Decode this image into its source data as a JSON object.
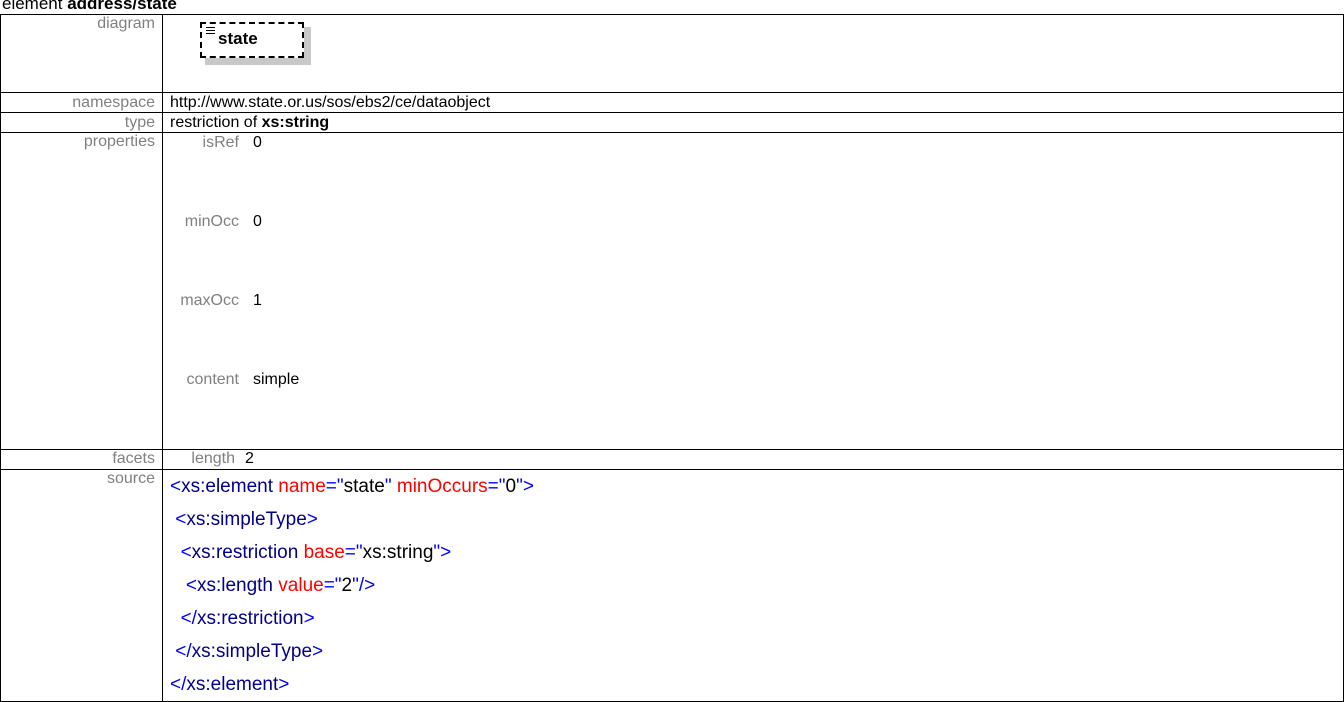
{
  "title": {
    "prefix": "element ",
    "name": "address/state"
  },
  "rows": {
    "diagram": {
      "label": "diagram",
      "element_name": "state"
    },
    "namespace": {
      "label": "namespace",
      "value": "http://www.state.or.us/sos/ebs2/ce/dataobject"
    },
    "type": {
      "label": "type",
      "prefix": "restriction of ",
      "base": "xs:string"
    },
    "properties": {
      "label": "properties",
      "items": [
        {
          "key": "isRef",
          "value": "0"
        },
        {
          "key": "minOcc",
          "value": "0"
        },
        {
          "key": "maxOcc",
          "value": "1"
        },
        {
          "key": "content",
          "value": "simple"
        }
      ]
    },
    "facets": {
      "label": "facets",
      "key": "length",
      "value": "2"
    },
    "source": {
      "label": "source",
      "lines": [
        {
          "indent": "",
          "tokens": [
            {
              "t": "<",
              "c": "bk"
            },
            {
              "t": "xs:element",
              "c": "tag"
            },
            {
              "t": " name",
              "c": "at"
            },
            {
              "t": "=\"",
              "c": "bk"
            },
            {
              "t": "state",
              "c": "av"
            },
            {
              "t": "\"",
              "c": "bk"
            },
            {
              "t": " minOccurs",
              "c": "at"
            },
            {
              "t": "=\"",
              "c": "bk"
            },
            {
              "t": "0",
              "c": "av"
            },
            {
              "t": "\">",
              "c": "bk"
            }
          ]
        },
        {
          "indent": " ",
          "tokens": [
            {
              "t": "<",
              "c": "bk"
            },
            {
              "t": "xs:simpleType",
              "c": "tag"
            },
            {
              "t": ">",
              "c": "bk"
            }
          ]
        },
        {
          "indent": "  ",
          "tokens": [
            {
              "t": "<",
              "c": "bk"
            },
            {
              "t": "xs:restriction",
              "c": "tag"
            },
            {
              "t": " base",
              "c": "at"
            },
            {
              "t": "=\"",
              "c": "bk"
            },
            {
              "t": "xs:string",
              "c": "av"
            },
            {
              "t": "\">",
              "c": "bk"
            }
          ]
        },
        {
          "indent": "   ",
          "tokens": [
            {
              "t": "<",
              "c": "bk"
            },
            {
              "t": "xs:length",
              "c": "tag"
            },
            {
              "t": " value",
              "c": "at"
            },
            {
              "t": "=\"",
              "c": "bk"
            },
            {
              "t": "2",
              "c": "av"
            },
            {
              "t": "\"/>",
              "c": "bk"
            }
          ]
        },
        {
          "indent": "  ",
          "tokens": [
            {
              "t": "</",
              "c": "bk"
            },
            {
              "t": "xs:restriction",
              "c": "tag"
            },
            {
              "t": ">",
              "c": "bk"
            }
          ]
        },
        {
          "indent": " ",
          "tokens": [
            {
              "t": "</",
              "c": "bk"
            },
            {
              "t": "xs:simpleType",
              "c": "tag"
            },
            {
              "t": ">",
              "c": "bk"
            }
          ]
        },
        {
          "indent": "",
          "tokens": [
            {
              "t": "</",
              "c": "bk"
            },
            {
              "t": "xs:element",
              "c": "tag"
            },
            {
              "t": ">",
              "c": "bk"
            }
          ]
        }
      ]
    }
  }
}
